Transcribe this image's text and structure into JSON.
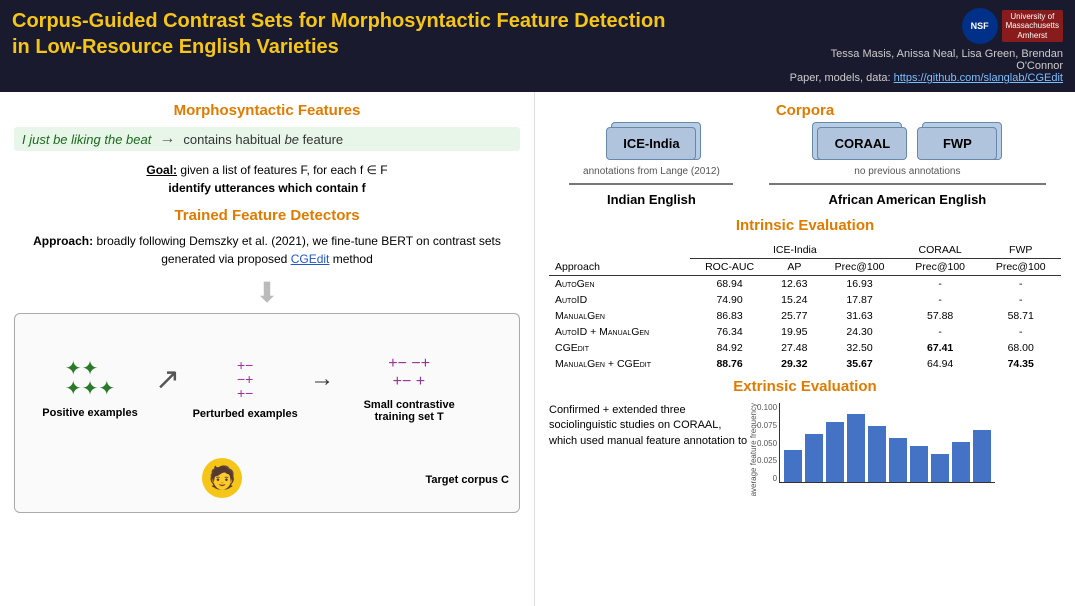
{
  "header": {
    "title_line1": "Corpus-Guided Contrast Sets for Morphosyntactic Feature Detection",
    "title_line2": "in Low-Resource English Varieties",
    "authors": "Tessa Masis, Anissa Neal, Lisa Green, Brendan O'Connor",
    "paper_label": "Paper, models, data:",
    "github_url": "https://github.com/slanglab/CGEdit",
    "nsf_label": "NSF",
    "umass_line1": "University of",
    "umass_line2": "Massachusetts",
    "umass_line3": "Amherst"
  },
  "morpho_section": {
    "heading": "Morphosyntactic Features",
    "example_text": "I just be liking the beat",
    "arrow": "→",
    "example_desc": "contains habitual",
    "be_word": "be",
    "feature_label": "feature",
    "goal_label": "Goal:",
    "goal_text": "given a list of features F, for each f ∈ F",
    "goal_text2": "identify utterances which contain f"
  },
  "trained_section": {
    "heading": "Trained Feature Detectors",
    "approach_bold": "Approach:",
    "approach_text": "broadly following Demszky et al. (2021), we fine-tune BERT on contrast sets generated via proposed",
    "cgedit_link": "CGEdit",
    "method_text": "method"
  },
  "diagram": {
    "positive_label": "Positive examples",
    "perturbed_label": "Perturbed examples",
    "small_set_label": "Small contrastive",
    "training_set_label": "training set T",
    "target_corpus_label": "Target corpus C"
  },
  "corpora_section": {
    "heading": "Corpora",
    "ice_label": "ICE-India",
    "coraal_label": "CORAAL",
    "fwp_label": "FWP",
    "annotation1": "annotations from Lange (2012)",
    "annotation2": "no previous annotations",
    "indian_english": "Indian English",
    "african_american": "African American English"
  },
  "intrinsic_section": {
    "heading": "Intrinsic Evaluation",
    "col_groups": [
      "ICE-India",
      "CORAAL",
      "FWP"
    ],
    "col_headers": [
      "Approach",
      "ROC-AUC",
      "AP",
      "Prec@100",
      "Prec@100",
      "Prec@100"
    ],
    "rows": [
      {
        "approach": "AutoGen",
        "roc": "68.94",
        "ap": "12.63",
        "prec1": "16.93",
        "prec2": "-",
        "prec3": "-"
      },
      {
        "approach": "AutoID",
        "roc": "74.90",
        "ap": "15.24",
        "prec1": "17.87",
        "prec2": "-",
        "prec3": "-"
      },
      {
        "approach": "ManualGen",
        "roc": "86.83",
        "ap": "25.77",
        "prec1": "31.63",
        "prec2": "57.88",
        "prec3": "58.71"
      },
      {
        "approach": "AutoID + ManualGen",
        "roc": "76.34",
        "ap": "19.95",
        "prec1": "24.30",
        "prec2": "-",
        "prec3": "-"
      },
      {
        "approach": "CGEdit",
        "roc": "84.92",
        "ap": "27.48",
        "prec1": "32.50",
        "prec2": "67.41",
        "prec3": "68.00",
        "bold2": true,
        "bold3": true
      },
      {
        "approach": "ManualGen + CGEdit",
        "roc": "88.76",
        "ap": "29.32",
        "prec1": "35.67",
        "prec2": "64.94",
        "prec3": "74.35",
        "bold_roc": true,
        "bold_ap": true,
        "bold1": true,
        "bold3b": true
      }
    ]
  },
  "extrinsic_section": {
    "heading": "Extrinsic Evaluation",
    "text1": "Confirmed + extended three sociolinguistic studies on CORAAL, which used manual feature annotation to",
    "chart_y_labels": [
      "0.100",
      "0.075",
      "0.050",
      "0.025",
      "0"
    ],
    "chart_bars": [
      40,
      60,
      75,
      85,
      70,
      55,
      45,
      35,
      50,
      65
    ],
    "y_axis_label": "average feature frequency"
  }
}
